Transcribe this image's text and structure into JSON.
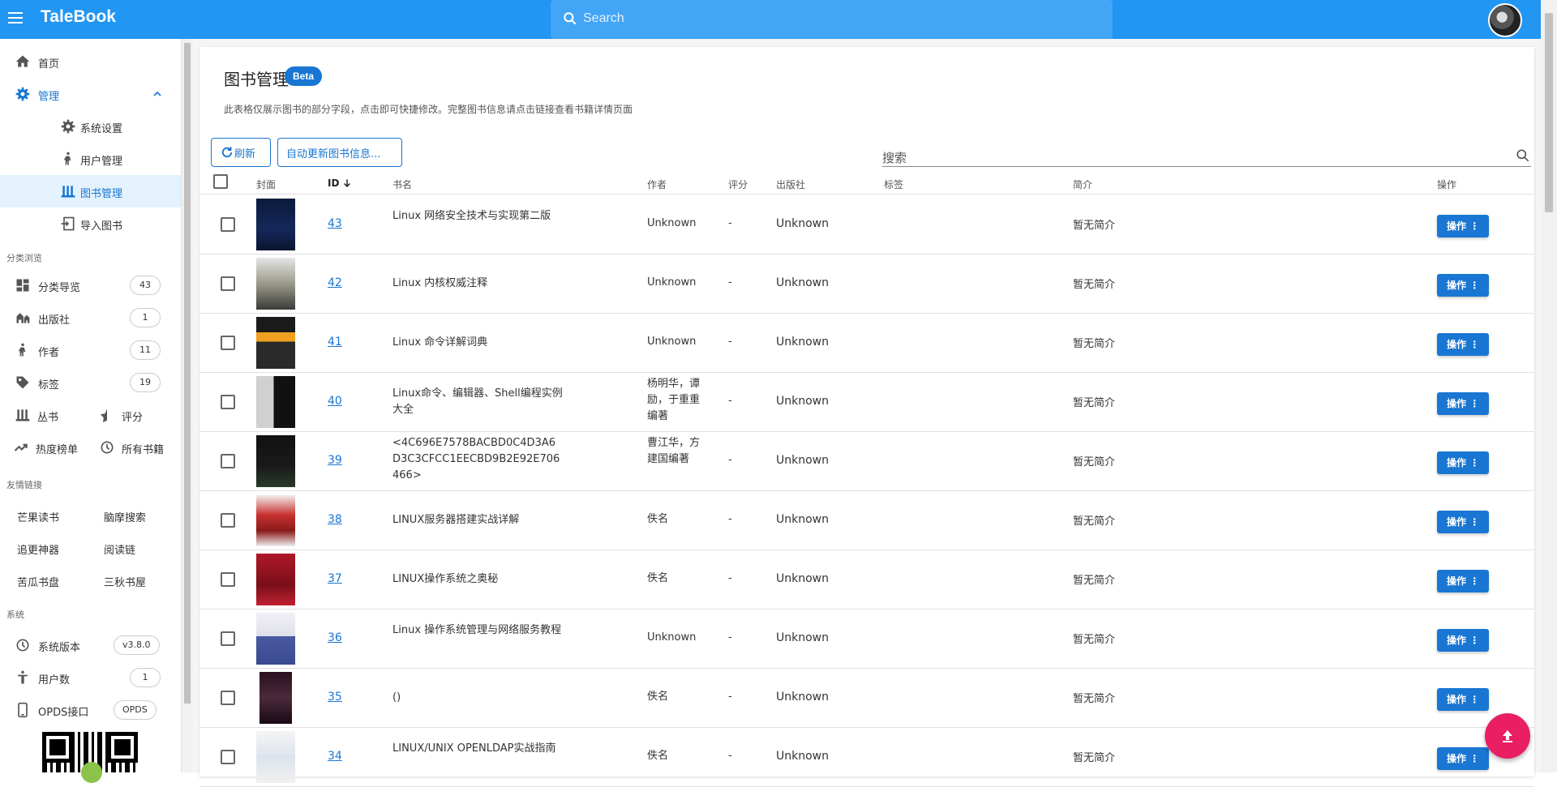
{
  "app": {
    "brand": "TaleBook",
    "search_placeholder": "Search"
  },
  "sidebar": {
    "home": "首页",
    "manage": "管理",
    "manage_items": [
      "系统设置",
      "用户管理",
      "图书管理",
      "导入图书"
    ],
    "browse_header": "分类浏览",
    "browse": [
      {
        "label": "分类导览",
        "count": "43"
      },
      {
        "label": "出版社",
        "count": "1"
      },
      {
        "label": "作者",
        "count": "11"
      },
      {
        "label": "标签",
        "count": "19"
      }
    ],
    "series": "丛书",
    "rating": "评分",
    "hot": "热度榜单",
    "all_books": "所有书籍",
    "links_header": "友情链接",
    "links": [
      "芒果读书",
      "脑摩搜索",
      "追更神器",
      "阅读链",
      "苦瓜书盘",
      "三秋书屋"
    ],
    "system_header": "系统",
    "system": [
      {
        "label": "系统版本",
        "badge": "v3.8.0"
      },
      {
        "label": "用户数",
        "badge": "1"
      },
      {
        "label": "OPDS接口",
        "badge": "OPDS"
      }
    ]
  },
  "page": {
    "title": "图书管理",
    "beta": "Beta",
    "description": "此表格仅展示图书的部分字段，点击即可快捷修改。完整图书信息请点击链接查看书籍详情页面",
    "refresh": "刷新",
    "auto_update": "自动更新图书信息...",
    "search_placeholder": "搜索"
  },
  "table": {
    "headers": {
      "cover": "封面",
      "id": "ID",
      "title": "书名",
      "author": "作者",
      "rating": "评分",
      "publisher": "出版社",
      "tags": "标签",
      "summary": "简介",
      "actions": "操作"
    },
    "rows": [
      {
        "id": "43",
        "title": "Linux 网络安全技术与实现第二版",
        "author": "Unknown",
        "rating": "-",
        "publisher": "Unknown",
        "tags": "",
        "summary": "暂无简介",
        "action": "操作"
      },
      {
        "id": "42",
        "title": "Linux 内核权威注释",
        "author": "Unknown",
        "rating": "-",
        "publisher": "Unknown",
        "tags": "",
        "summary": "暂无简介",
        "action": "操作"
      },
      {
        "id": "41",
        "title": "Linux 命令详解词典",
        "author": "Unknown",
        "rating": "-",
        "publisher": "Unknown",
        "tags": "",
        "summary": "暂无简介",
        "action": "操作"
      },
      {
        "id": "40",
        "title": "Linux命令、编辑器、Shell编程实例大全",
        "author": "杨明华，谭励，于重重编著",
        "rating": "-",
        "publisher": "Unknown",
        "tags": "",
        "summary": "暂无简介",
        "action": "操作"
      },
      {
        "id": "39",
        "title": "<4C696E7578BACBD0C4D3A6D3C3CFCC1EECBD9B2E92E706466>",
        "author": "曹江华，方建国编著",
        "rating": "-",
        "publisher": "Unknown",
        "tags": "",
        "summary": "暂无简介",
        "action": "操作"
      },
      {
        "id": "38",
        "title": "LINUX服务器搭建实战详解",
        "author": "佚名",
        "rating": "-",
        "publisher": "Unknown",
        "tags": "",
        "summary": "暂无简介",
        "action": "操作"
      },
      {
        "id": "37",
        "title": "LINUX操作系统之奥秘",
        "author": "佚名",
        "rating": "-",
        "publisher": "Unknown",
        "tags": "",
        "summary": "暂无简介",
        "action": "操作"
      },
      {
        "id": "36",
        "title": "Linux 操作系统管理与网络服务教程",
        "author": "Unknown",
        "rating": "-",
        "publisher": "Unknown",
        "tags": "",
        "summary": "暂无简介",
        "action": "操作"
      },
      {
        "id": "35",
        "title": "()",
        "author": "佚名",
        "rating": "-",
        "publisher": "Unknown",
        "tags": "",
        "summary": "暂无简介",
        "action": "操作"
      },
      {
        "id": "34",
        "title": "LINUX/UNIX OPENLDAP实战指南",
        "author": "佚名",
        "rating": "-",
        "publisher": "Unknown",
        "tags": "",
        "summary": "暂无简介",
        "action": "操作"
      }
    ]
  },
  "colors": {
    "appbar": "#2196f3",
    "primary": "#1976d2",
    "fab": "#e91e63"
  }
}
